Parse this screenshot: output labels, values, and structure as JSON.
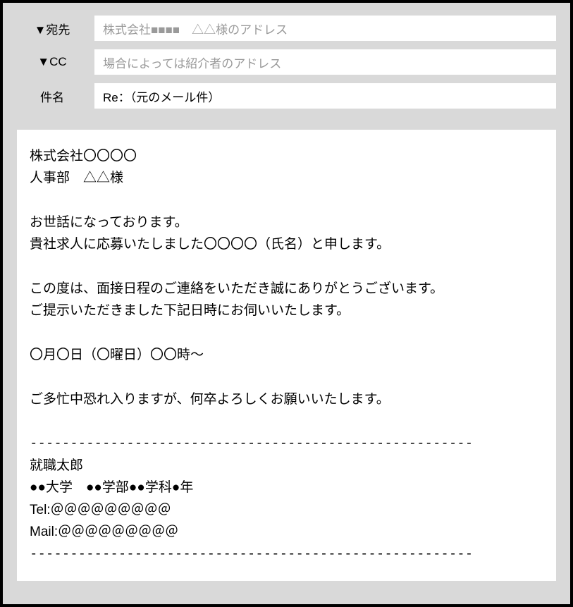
{
  "header": {
    "to_label": "▼宛先",
    "to_value": "株式会社■■■■　△△様のアドレス",
    "cc_label": "▼CC",
    "cc_value": "場合によっては紹介者のアドレス",
    "subject_label": "件名",
    "subject_value": "Re：（元のメール件）"
  },
  "body": {
    "recipient_company": "株式会社〇〇〇〇",
    "recipient_person": "人事部　△△様",
    "greeting1": "お世話になっております。",
    "greeting2": "貴社求人に応募いたしました〇〇〇〇（氏名）と申します。",
    "para2_line1": "この度は、面接日程のご連絡をいただき誠にありがとうございます。",
    "para2_line2": "ご提示いただきました下記日時にお伺いいたします。",
    "datetime": "〇月〇日（〇曜日）〇〇時～",
    "closing": "ご多忙中恐れ入りますが、何卒よろしくお願いいたします。",
    "divider": "-------------------------------------------------------",
    "sig_name": "就職太郎",
    "sig_school": "●●大学　●●学部●●学科●年",
    "sig_tel": "Tel:＠＠＠＠＠＠＠＠＠",
    "sig_mail": "Mail:＠＠＠＠＠＠＠＠＠"
  }
}
